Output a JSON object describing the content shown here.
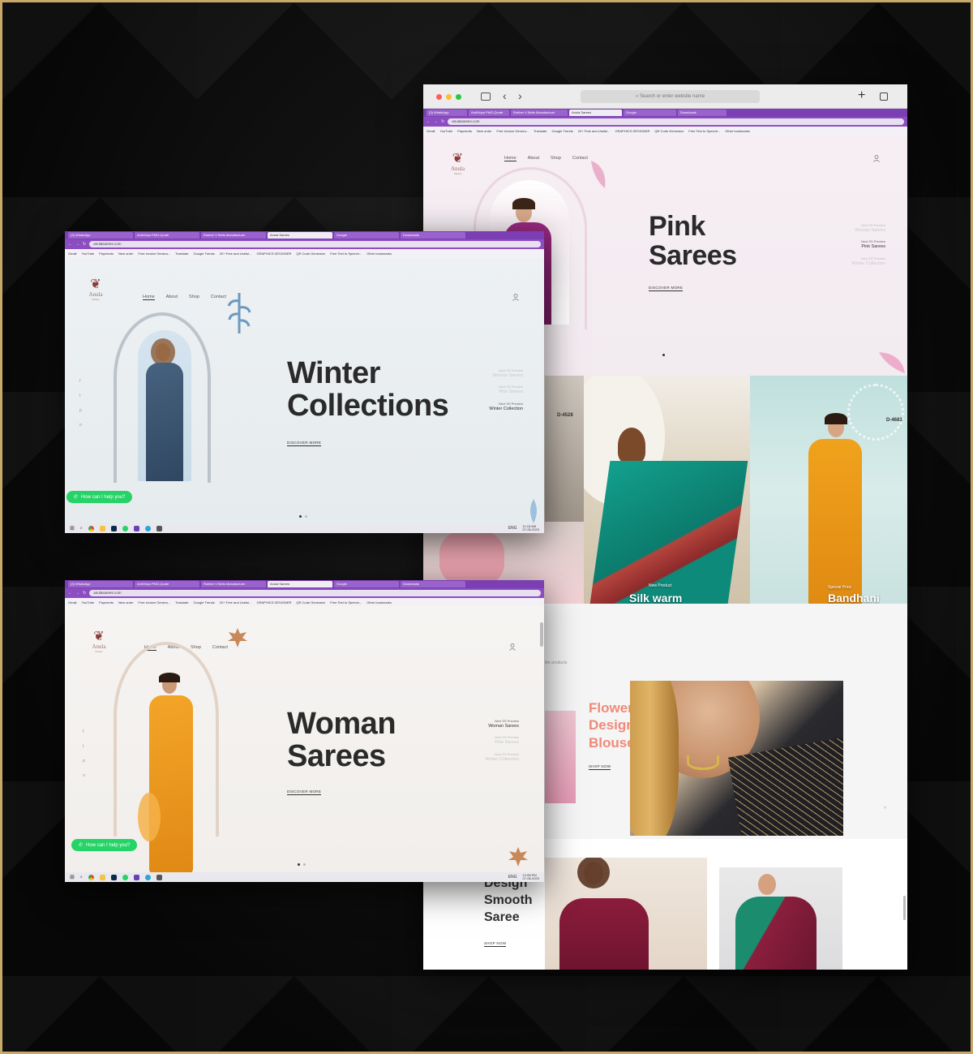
{
  "colors": {
    "frame_border": "#c9a96a",
    "tab_purple": "#7b3fb3",
    "whatsapp": "#25d366",
    "accent_salmon": "#ef8a78"
  },
  "browser_tabs": [
    "(3) WhatsApp",
    "AntiVidya PMO-Quote",
    "Rubber V Belts Manufacturer",
    "Anula Sarees",
    "Google",
    "Downloads"
  ],
  "url": "anulasarees.com",
  "safari_search_placeholder": "Search or enter website name",
  "bookmarks": [
    "Gmail",
    "YouTube",
    "Payments",
    "New order",
    "Free invoice Genera...",
    "Translate",
    "Google Trends",
    "20+ Free and Useful...",
    "GRAPHICS DESIGNER",
    "QR Code Generator",
    "Free Text to Speech...",
    "Other bookmarks"
  ],
  "logo": {
    "name": "Anula",
    "sub": "Sarees"
  },
  "nav": [
    "Home",
    "About",
    "Shop",
    "Contact"
  ],
  "slide_list": [
    {
      "pre": "Next SS Preview",
      "label": "Woman Sarees"
    },
    {
      "pre": "Next SS Preview",
      "label": "Pink Sarees"
    },
    {
      "pre": "Next SS Preview",
      "label": "Winter Collection"
    }
  ],
  "discover": "DISCOVER MORE",
  "whatsapp": "How can I help you?",
  "social_icons": [
    "facebook-icon",
    "twitter-icon",
    "pinterest-icon",
    "instagram-icon"
  ],
  "winter": {
    "title_line1": "Winter",
    "title_line2": "Collections",
    "time": "11:18 AM",
    "date": "07-06-2023",
    "lang": "ENG"
  },
  "woman": {
    "title_line1": "Woman",
    "title_line2": "Sarees",
    "time": "12:08 PM",
    "date": "07-06-2023",
    "lang": "ENG"
  },
  "pink": {
    "title_line1": "Pink",
    "title_line2": "Sarees"
  },
  "products": {
    "code_left": "D-4528",
    "code_right": "D-4683",
    "silk_pre": "New Product",
    "silk_label": "Silk warm",
    "bandhani_pre": "Special Price",
    "bandhani_label": "Bandhani",
    "small_text": "the products"
  },
  "flower": {
    "line1": "Flower",
    "line2": "Design",
    "line3": "Blouse",
    "cta": "SHOP NOW"
  },
  "smooth": {
    "line1": "Design",
    "line2": "Smooth",
    "line3": "Saree",
    "cta": "SHOP NOW"
  }
}
